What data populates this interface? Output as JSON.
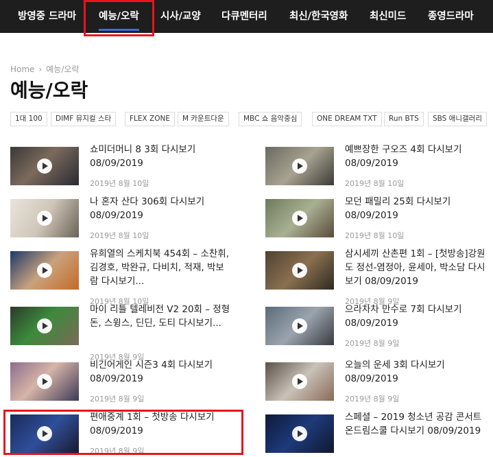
{
  "nav": {
    "items": [
      "방영중 드라마",
      "예능/오락",
      "시사/교양",
      "다큐멘터리",
      "최신/한국영화",
      "최신미드",
      "종영드라마"
    ],
    "active_index": 1,
    "accent": "#3b6fd6",
    "highlight": "#e8141c"
  },
  "breadcrumb": {
    "home": "Home",
    "sep": "›",
    "current": "예능/오락"
  },
  "page_title": "예능/오락",
  "tags": [
    "1대 100",
    "DIMF 뮤지컬 스타",
    "FLEX ZONE",
    "M 카운트다운",
    "MBC 쇼 음악중심",
    "ONE DREAM TXT",
    "Run BTS",
    "SBS 애니갤러리"
  ],
  "posts": {
    "left": [
      {
        "title": "쇼미더머니 8 3회 다시보기 08/09/2019",
        "date": "2019년 8월 10일"
      },
      {
        "title": "나 혼자 산다 306회 다시보기 08/09/2019",
        "date": "2019년 8월 10일"
      },
      {
        "title": "유희열의 스케치북 454회 – 소찬휘, 김경호, 박완규, 다비치, 적재, 박보람 다시보기...",
        "date": "2019년 8월 10일"
      },
      {
        "title": "마이 리틀 텔레비전 V2 20회 – 정형돈, 스윙스, 딘딘, 도티 다시보기...",
        "date": "2019년 8월 9일"
      },
      {
        "title": "비긴어게인 시즌3 4회 다시보기 08/09/2019",
        "date": "2019년 8월 9일"
      },
      {
        "title": "편애중계 1회 – 첫방송 다시보기 08/09/2019",
        "date": "2019년 8월 9일"
      }
    ],
    "right": [
      {
        "title": "예쁘장한 구오즈 4회 다시보기 08/09/2019",
        "date": "2019년 8월 10일"
      },
      {
        "title": "모던 패밀리 25회 다시보기 08/09/2019",
        "date": "2019년 8월 10일"
      },
      {
        "title": "삼시세끼 산촌편 1회 – [첫방송]강원도 정선-염정아, 윤세아, 박소담 다시보기 08/09/2019",
        "date": "2019년 8월 9일"
      },
      {
        "title": "으라차차 만수로 7회 다시보기 08/09/2019",
        "date": "2019년 8월 9일"
      },
      {
        "title": "오늘의 운세 3회 다시보기 08/09/2019",
        "date": "2019년 8월 9일"
      },
      {
        "title": "스페셜 – 2019 청소년 공감 콘서트 온드림스쿨 다시보기 08/09/2019",
        "date": ""
      }
    ]
  }
}
